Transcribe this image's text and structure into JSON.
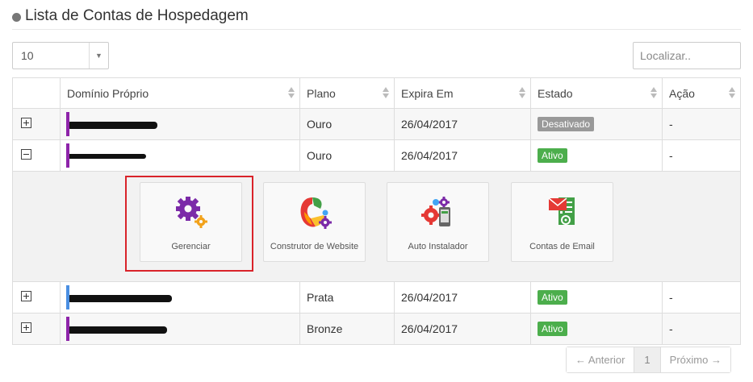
{
  "header": {
    "title": "Lista de Contas de Hospedagem",
    "icon": "globe-icon"
  },
  "controls": {
    "page_size_value": "10",
    "search_placeholder": "Localizar.."
  },
  "table": {
    "columns": [
      "Domínio Próprio",
      "Plano",
      "Expira Em",
      "Estado",
      "Ação"
    ],
    "rows": [
      {
        "plan": "Ouro",
        "expires": "26/04/2017",
        "status": "Desativado",
        "status_color": "#999999",
        "action": "-",
        "bar_color": "#8e24aa",
        "expanded": false
      },
      {
        "plan": "Ouro",
        "expires": "26/04/2017",
        "status": "Ativo",
        "status_color": "#4cae4c",
        "action": "-",
        "bar_color": "#8e24aa",
        "expanded": true
      },
      {
        "plan": "Prata",
        "expires": "26/04/2017",
        "status": "Ativo",
        "status_color": "#4cae4c",
        "action": "-",
        "bar_color": "#4a8fe2",
        "expanded": false
      },
      {
        "plan": "Bronze",
        "expires": "26/04/2017",
        "status": "Ativo",
        "status_color": "#4cae4c",
        "action": "-",
        "bar_color": "#8e24aa",
        "expanded": false
      }
    ]
  },
  "tools": [
    {
      "label": "Gerenciar",
      "icon": "gear-icon"
    },
    {
      "label": "Construtor de Website",
      "icon": "website-builder-icon"
    },
    {
      "label": "Auto Instalador",
      "icon": "auto-installer-icon"
    },
    {
      "label": "Contas de Email",
      "icon": "email-accounts-icon"
    }
  ],
  "pagination": {
    "prev": "← Anterior",
    "page": "1",
    "next": "Próximo →"
  },
  "colors": {
    "highlight": "#d9232a",
    "active": "#4cae4c",
    "inactive": "#999999",
    "purple": "#8e24aa"
  }
}
